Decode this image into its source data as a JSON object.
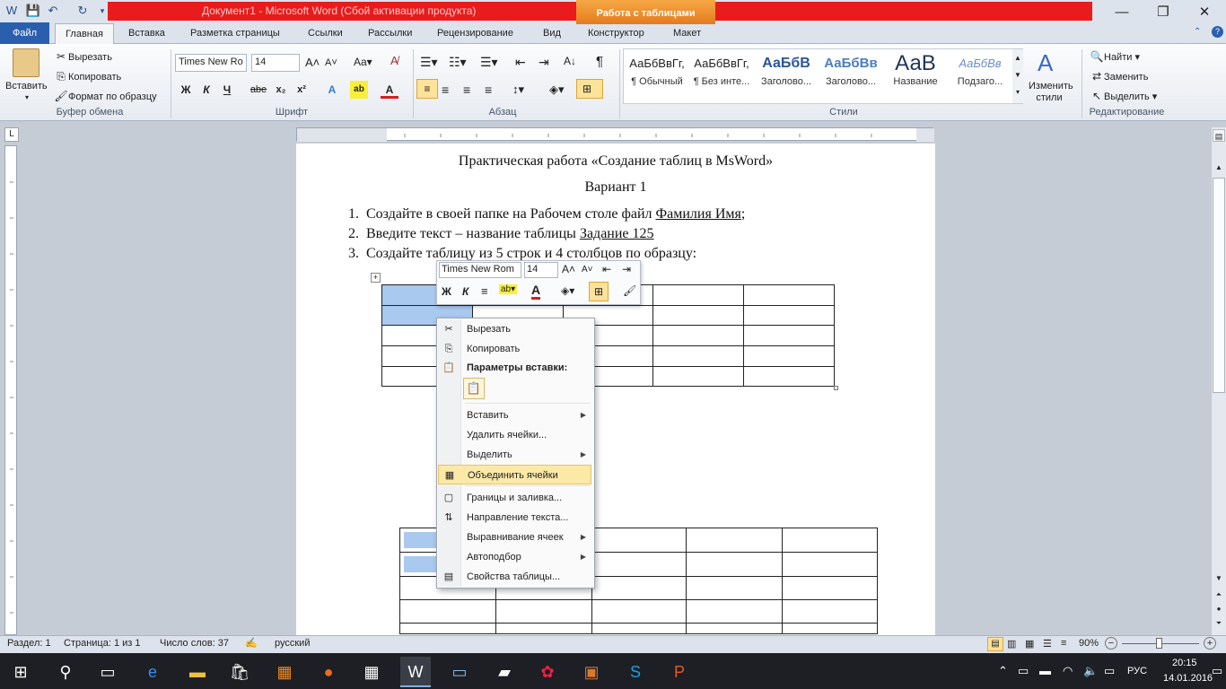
{
  "window": {
    "title": "Документ1 - Microsoft Word (Сбой активации продукта)",
    "context_tab_group": "Работа с таблицами",
    "controls": [
      "—",
      "❐",
      "✕"
    ]
  },
  "tabs": [
    "Файл",
    "Главная",
    "Вставка",
    "Разметка страницы",
    "Ссылки",
    "Рассылки",
    "Рецензирование",
    "Вид",
    "Конструктор",
    "Макет"
  ],
  "clipboard": {
    "paste": "Вставить",
    "cut": "Вырезать",
    "copy": "Копировать",
    "format_painter": "Формат по образцу",
    "label": "Буфер обмена"
  },
  "font": {
    "name": "Times New Ro",
    "size": "14",
    "label": "Шрифт",
    "bold": "Ж",
    "italic": "К",
    "underline": "Ч",
    "strike": "abe"
  },
  "paragraph": {
    "label": "Абзац"
  },
  "styles": {
    "label": "Стили",
    "items": [
      {
        "sample": "АаБбВвГг,",
        "name": "¶ Обычный"
      },
      {
        "sample": "АаБбВвГг,",
        "name": "¶ Без инте..."
      },
      {
        "sample": "АаБбВ",
        "name": "Заголово..."
      },
      {
        "sample": "АаБбВв",
        "name": "Заголово..."
      },
      {
        "sample": "АаВ",
        "name": "Название"
      },
      {
        "sample": "АаБбВв",
        "name": "Подзаго..."
      }
    ],
    "change": "Изменить стили"
  },
  "editing": {
    "label": "Редактирование",
    "find": "Найти",
    "replace": "Заменить",
    "select": "Выделить"
  },
  "document": {
    "title": "Практическая работа «Создание таблиц в MsWord»",
    "variant": "Вариант 1",
    "list": [
      {
        "num": "1.",
        "text": "Создайте в своей папке на Рабочем столе  файл ",
        "u": "Фамилия Имя",
        "tail": ";"
      },
      {
        "num": "2.",
        "text": "Введите текст – название таблицы ",
        "u": "Задание 125",
        "tail": ""
      },
      {
        "num": "3.",
        "text": "Создайте таблицу из 5 строк и 4 столбцов по образцу:",
        "u": "",
        "tail": ""
      }
    ]
  },
  "mini_toolbar": {
    "font": "Times New Rom",
    "size": "14"
  },
  "context_menu": {
    "items": [
      {
        "label": "Вырезать",
        "icon": "scissors-icon"
      },
      {
        "label": "Копировать",
        "icon": "copy-icon"
      },
      {
        "label": "Параметры вставки:",
        "icon": "paste-icon"
      },
      {
        "label": "Вставить",
        "icon": ""
      },
      {
        "label": "Удалить ячейки...",
        "icon": ""
      },
      {
        "label": "Выделить",
        "icon": ""
      },
      {
        "label": "Объединить ячейки",
        "icon": "merge-cells-icon"
      },
      {
        "label": "Границы и заливка...",
        "icon": "borders-icon"
      },
      {
        "label": "Направление текста...",
        "icon": "text-direction-icon"
      },
      {
        "label": "Выравнивание ячеек",
        "icon": ""
      },
      {
        "label": "Автоподбор",
        "icon": ""
      },
      {
        "label": "Свойства таблицы...",
        "icon": "table-properties-icon"
      }
    ]
  },
  "status": {
    "section": "Раздел: 1",
    "page": "Страница: 1 из 1",
    "words": "Число слов: 37",
    "lang": "русский",
    "zoom": "90%"
  },
  "taskbar": {
    "lang": "РУС",
    "time": "20:15",
    "date": "14.01.2016"
  }
}
